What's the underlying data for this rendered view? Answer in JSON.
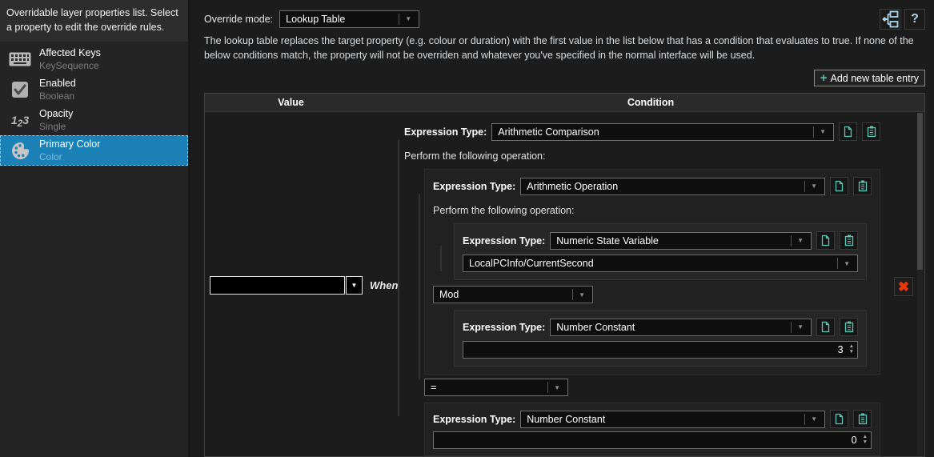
{
  "icons": {
    "dropdown_arrow": "▼",
    "spinner_up": "▲",
    "spinner_down": "▼",
    "plus": "+",
    "help": "?",
    "delete": "✖"
  },
  "colors": {
    "accent_blue": "#1a80b6",
    "teal": "#5ec6b4",
    "help_blue": "#a9d5e8",
    "delete_red": "#e6380e"
  },
  "sidebar": {
    "header": "Overridable layer properties list. Select a property to edit the override rules.",
    "items": [
      {
        "label": "Affected Keys",
        "type": "KeySequence"
      },
      {
        "label": "Enabled",
        "type": "Boolean"
      },
      {
        "label": "Opacity",
        "type": "Single"
      },
      {
        "label": "Primary Color",
        "type": "Color"
      }
    ]
  },
  "toolbar": {
    "override_mode_label": "Override mode:",
    "override_mode_value": "Lookup Table",
    "description": "The lookup table replaces the target property (e.g. colour or duration) with the first value in the list below that has a condition that evaluates to true. If none of the below conditions match, the property will not be overriden and whatever you've specified in the normal interface will be used.",
    "add_button_label": "Add new table entry"
  },
  "labels": {
    "expression_type": "Expression Type:",
    "perform_operation": "Perform the following operation:",
    "when": "When"
  },
  "table": {
    "columns": [
      "Value",
      "Condition"
    ],
    "entry": {
      "value_color": "#ff0000",
      "condition": {
        "root_type": "Arithmetic Comparison",
        "operand1": {
          "type": "Arithmetic Operation",
          "operand1": {
            "type": "Numeric State Variable",
            "variable": "LocalPCInfo/CurrentSecond"
          },
          "operator": "Mod",
          "operand2": {
            "type": "Number Constant",
            "value": "3"
          }
        },
        "operator": "=",
        "operand2": {
          "type": "Number Constant",
          "value": "0"
        }
      }
    }
  }
}
